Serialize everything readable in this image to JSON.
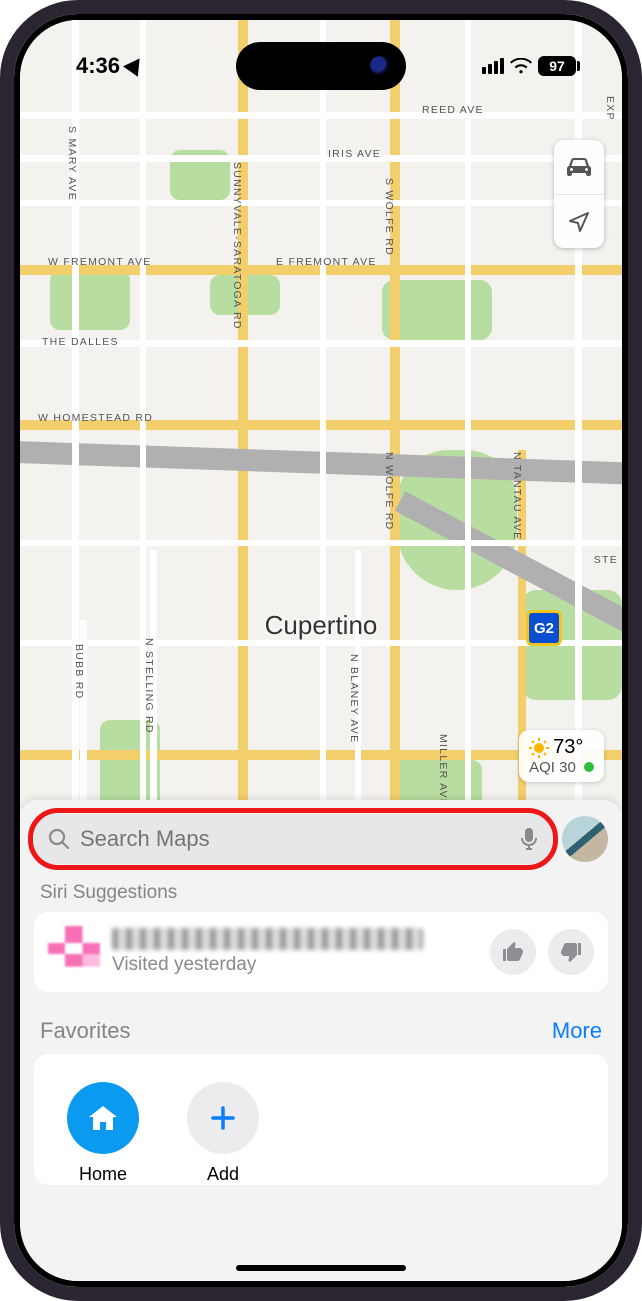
{
  "statusbar": {
    "time": "4:36",
    "battery": "97"
  },
  "map": {
    "city": "Cupertino",
    "roads": {
      "reed": "REED AVE",
      "iris": "IRIS AVE",
      "wfremont": "W FREMONT AVE",
      "efremont": "E FREMONT AVE",
      "dalles": "THE DALLES",
      "homestead": "W HOMESTEAD RD",
      "mary": "S MARY AVE",
      "sunnyvale": "SUNNYVALE-SARATOGA RD",
      "wolfe_n": "S WOLFE RD",
      "wolfe_s": "N WOLFE RD",
      "tantau": "N TANTAU AVE",
      "bubb": "BUBB RD",
      "stelling": "N STELLING RD",
      "blaney": "N BLANEY AVE",
      "miller": "MILLER AVE",
      "exp": "EXP",
      "ste": "STE"
    },
    "shield": "G2",
    "weather": {
      "temp": "73°",
      "aqi_label": "AQI",
      "aqi_value": "30"
    }
  },
  "sheet": {
    "search_placeholder": "Search Maps",
    "siri_title": "Siri Suggestions",
    "suggestion_subtitle": "Visited yesterday",
    "favorites_title": "Favorites",
    "more_label": "More",
    "favorites": {
      "home": "Home",
      "add": "Add"
    }
  }
}
